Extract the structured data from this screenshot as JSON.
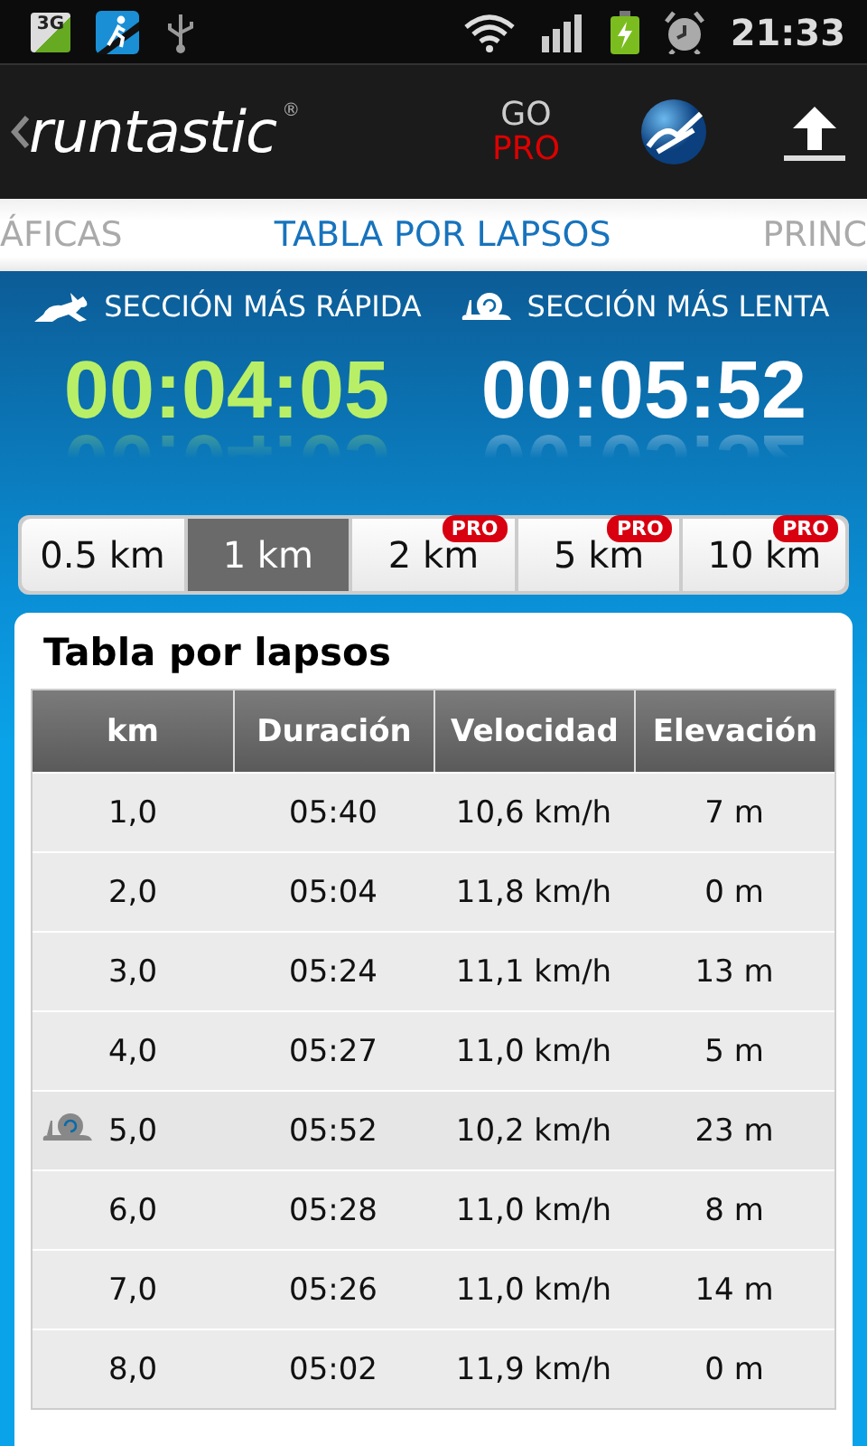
{
  "status_bar": {
    "network_badge": "3G",
    "time": "21:33"
  },
  "action_bar": {
    "logo": "runtastic",
    "logo_mark": "®",
    "go_pro": {
      "top": "GO",
      "bottom": "PRO"
    }
  },
  "page_tabs": [
    {
      "label": "ÁFICAS",
      "selected": false
    },
    {
      "label": "TABLA POR LAPSOS",
      "selected": true
    },
    {
      "label": "PRINC",
      "selected": false
    }
  ],
  "summary": [
    {
      "kind": "fast",
      "label": "SECCIÓN MÁS RÁPIDA",
      "time": "00:04:05"
    },
    {
      "kind": "slow",
      "label": "SECCIÓN MÁS LENTA",
      "time": "00:05:52"
    }
  ],
  "segments": [
    {
      "label": "0.5 km",
      "selected": false
    },
    {
      "label": "1 km",
      "selected": true
    },
    {
      "label": "2 km",
      "selected": false,
      "badge": "PRO"
    },
    {
      "label": "5 km",
      "selected": false,
      "badge": "PRO"
    },
    {
      "label": "10 km",
      "selected": false,
      "badge": "PRO"
    }
  ],
  "table": {
    "title": "Tabla por lapsos",
    "columns": [
      "km",
      "Duración",
      "Velocidad",
      "Elevación"
    ],
    "rows": [
      {
        "cells": [
          "1,0",
          "05:40",
          "10,6 km/h",
          "7 m"
        ],
        "slowest": false
      },
      {
        "cells": [
          "2,0",
          "05:04",
          "11,8 km/h",
          "0 m"
        ],
        "slowest": false
      },
      {
        "cells": [
          "3,0",
          "05:24",
          "11,1 km/h",
          "13 m"
        ],
        "slowest": false
      },
      {
        "cells": [
          "4,0",
          "05:27",
          "11,0 km/h",
          "5 m"
        ],
        "slowest": false
      },
      {
        "cells": [
          "5,0",
          "05:52",
          "10,2 km/h",
          "23 m"
        ],
        "slowest": true
      },
      {
        "cells": [
          "6,0",
          "05:28",
          "11,0 km/h",
          "8 m"
        ],
        "slowest": false
      },
      {
        "cells": [
          "7,0",
          "05:26",
          "11,0 km/h",
          "14 m"
        ],
        "slowest": false
      },
      {
        "cells": [
          "8,0",
          "05:02",
          "11,9 km/h",
          "0 m"
        ],
        "slowest": false
      }
    ]
  }
}
